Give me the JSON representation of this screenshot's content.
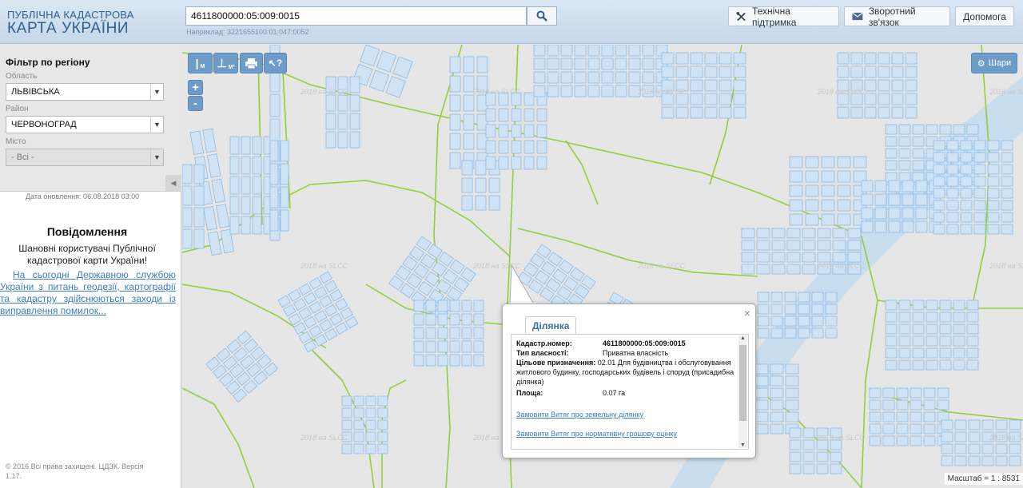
{
  "header": {
    "logo_line1": "ПУБЛІЧНА КАДАСТРОВА",
    "logo_line2": "КАРТА УКРАЇНИ",
    "search_value": "4611800000:05:009:0015",
    "search_icon": "search-icon",
    "example": "Наприклад: 3221655100:01:047:0052",
    "buttons": [
      {
        "label": "Технічна підтримка",
        "icon": "tools-icon"
      },
      {
        "label": "Зворотний зв'язок",
        "icon": "envelope-icon"
      },
      {
        "label": "Допомога"
      }
    ]
  },
  "sidebar": {
    "filter_title": "Фільтр по регіону",
    "oblast_label": "Область",
    "oblast_value": "ЛЬВІВСЬКА",
    "rayon_label": "Район",
    "rayon_value": "ЧЕРВОНОГРАД",
    "misto_label": "Місто",
    "misto_value": "- Всі -",
    "updated": "Дата оновлення: 06.08.2018 03:00",
    "notice_title": "Повідомлення",
    "notice_text": "Шановні користувачі Публічної кадастрової карти України!",
    "notice_link": "На сьогодні Державною службою України з питань геодезії, картографії та кадастру здійснюються заходи із виправлення помилок...",
    "copyright": "© 2016 Всі права захищені. ЦДЗК. Версія 1.17."
  },
  "map": {
    "tools": [
      "measure-line-icon",
      "measure-area-icon",
      "print-icon",
      "identify-icon"
    ],
    "tool_labels": [
      "М",
      "М²"
    ],
    "zoom_in": "+",
    "zoom_out": "-",
    "layers_label": "Шари",
    "watermark": "2018 на SLCC",
    "scale_label": "Масштаб = 1 : 8531",
    "colors": {
      "background": "#e6e6e6",
      "parcel_fill": "#cfe3f5",
      "parcel_stroke": "#8db9e3",
      "road_line": "#93cf3b",
      "water": "#c4dbee"
    }
  },
  "popup": {
    "tab": "Ділянка",
    "close": "×",
    "fields": [
      {
        "label": "Кадастр.номер:",
        "value": "4611800000:05:009:0015"
      },
      {
        "label": "Тип власності:",
        "value": "Приватна власність"
      },
      {
        "label": "Цільове призначення:",
        "value": "02.01 Для будівництва і обслуговування житлового будинку, господарських будівель і споруд (присадибна ділянка)"
      },
      {
        "label": "Площа:",
        "value": "0.07 га"
      }
    ],
    "links": [
      "Замовити Витяг про земельну ділянку",
      "Замовити Витяг про нормативну грошову оцінку"
    ]
  }
}
